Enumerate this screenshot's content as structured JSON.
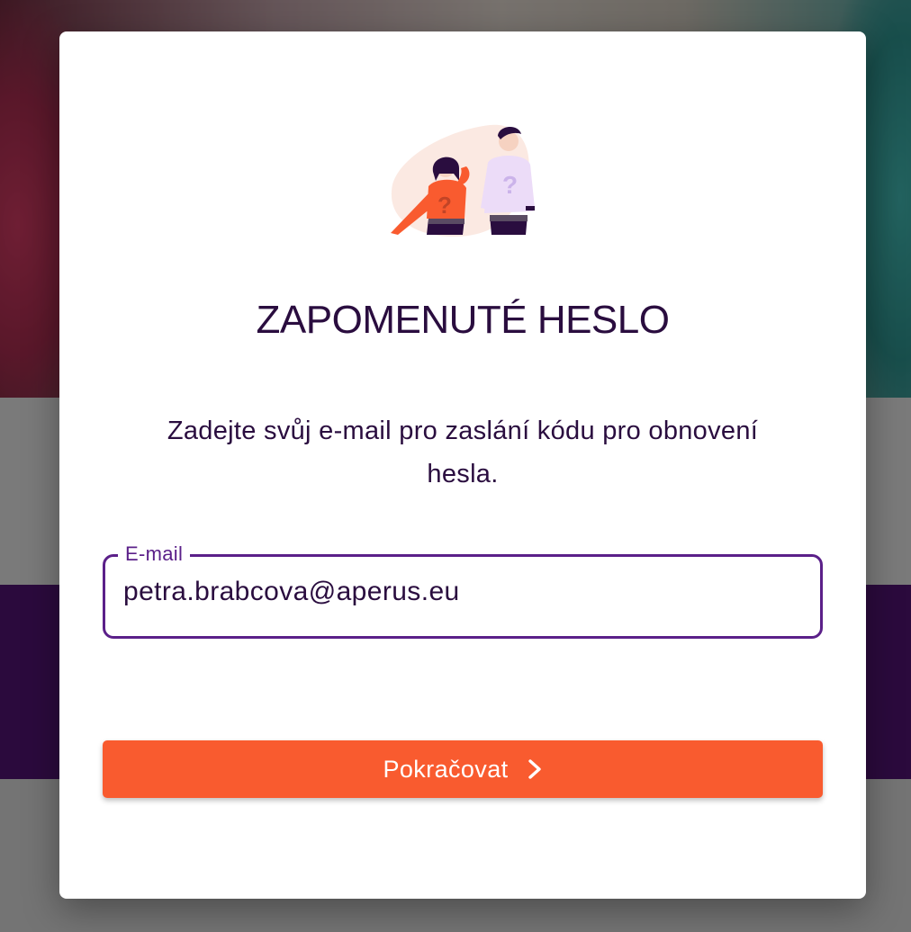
{
  "dialog": {
    "title": "ZAPOMENUTÉ HESLO",
    "description": "Zadejte svůj e-mail pro zaslání kódu pro obnovení hesla.",
    "illustration_icon": "confused-people-illustration",
    "email_field": {
      "label": "E-mail",
      "value": "petra.brabcova@aperus.eu"
    },
    "continue_button": {
      "label": "Pokračovat",
      "icon": "chevron-right-icon"
    }
  },
  "colors": {
    "primary_dark": "#2a0d3f",
    "field_border": "#5b2089",
    "accent_orange": "#f95b2f",
    "background_purple": "#2b0a3d"
  }
}
